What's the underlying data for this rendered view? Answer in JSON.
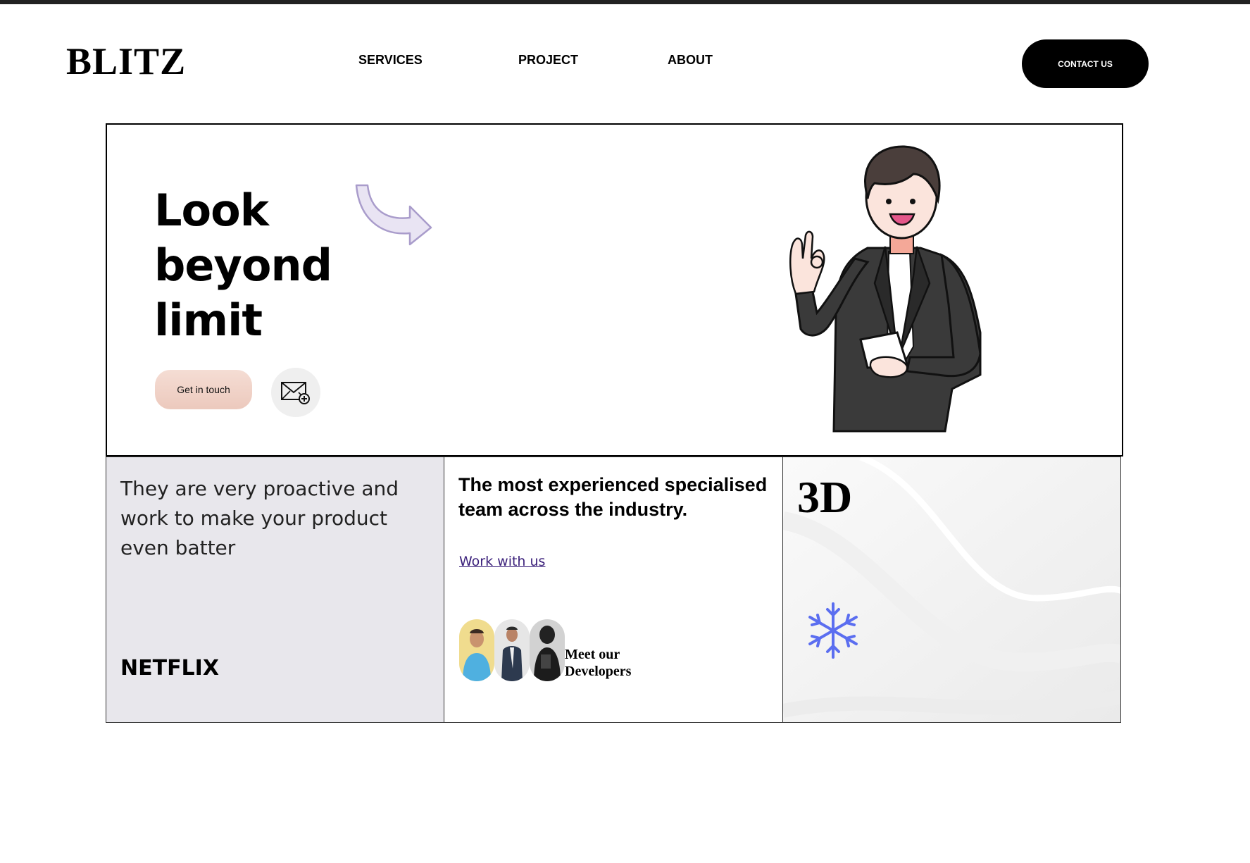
{
  "header": {
    "logo": "BLITZ",
    "nav": [
      {
        "label": "SERVICES"
      },
      {
        "label": "PROJECT"
      },
      {
        "label": "ABOUT"
      }
    ],
    "contact_label": "CONTACT US"
  },
  "hero": {
    "title_lines": [
      "Look",
      "beyond",
      "limit"
    ],
    "cta_label": "Get in touch",
    "icons": {
      "arrow": "curved-arrow-icon",
      "mail": "mail-add-icon",
      "illustration": "businessman-ok-gesture"
    }
  },
  "cards": {
    "testimonial": {
      "quote": "They are very proactive and work to make your product even batter",
      "brand": "NETFLIX"
    },
    "team": {
      "title": "The most experienced specialised team across the industry.",
      "link_label": "Work with us",
      "developers_label": "Meet our Developers"
    },
    "three_d": {
      "label": "3D",
      "icon": "snowflake-icon"
    }
  },
  "colors": {
    "accent_button": "#ecc9bd",
    "card_gray": "#e8e7ec",
    "snowflake": "#5b6ef0",
    "arrow": "#c9c0e0",
    "link": "#3a1f7a"
  }
}
